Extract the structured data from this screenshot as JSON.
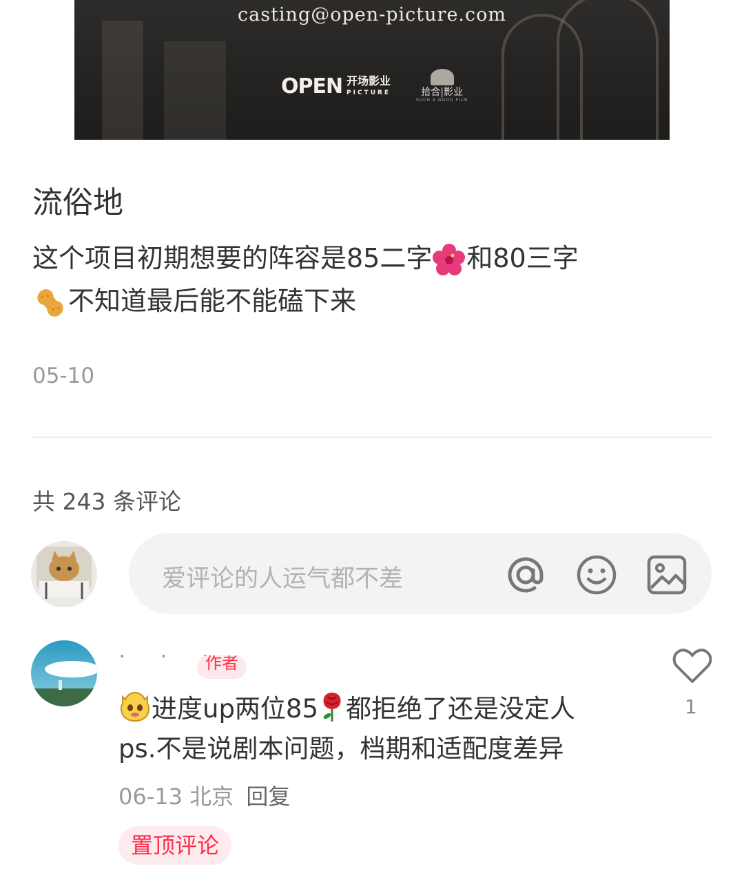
{
  "banner": {
    "email": "casting@open-picture.com",
    "logo_open": "OPEN",
    "logo_open_cn": "开场影业",
    "logo_open_en": "PICTURE",
    "logo_second_cn": "拾合|影业",
    "logo_second_en": "SUCH A GOOD FILM"
  },
  "post": {
    "title": "流俗地",
    "body_line1": "这个项目初期想要的阵容是85二字",
    "body_line1b": "和80三字",
    "body_line2": "不知道最后能不能磕下来",
    "date": "05-10"
  },
  "comments_header": {
    "count_label": "共 243 条评论"
  },
  "comment_input": {
    "placeholder": "爱评论的人运气都不差",
    "icons": [
      "at-icon",
      "emoji-icon",
      "image-icon"
    ]
  },
  "comment": {
    "author_tag": "作者",
    "line1": "进度up两位85",
    "line1b": "都拒绝了还是没定人",
    "line2": "ps.不是说剧本问题，档期和适配度差异",
    "date": "06-13",
    "location": "北京",
    "reply_label": "回复",
    "pinned_label": "置顶评论",
    "like_count": "1"
  },
  "colors": {
    "accent": "#ff2e4d",
    "muted": "#999999",
    "text": "#333333"
  }
}
